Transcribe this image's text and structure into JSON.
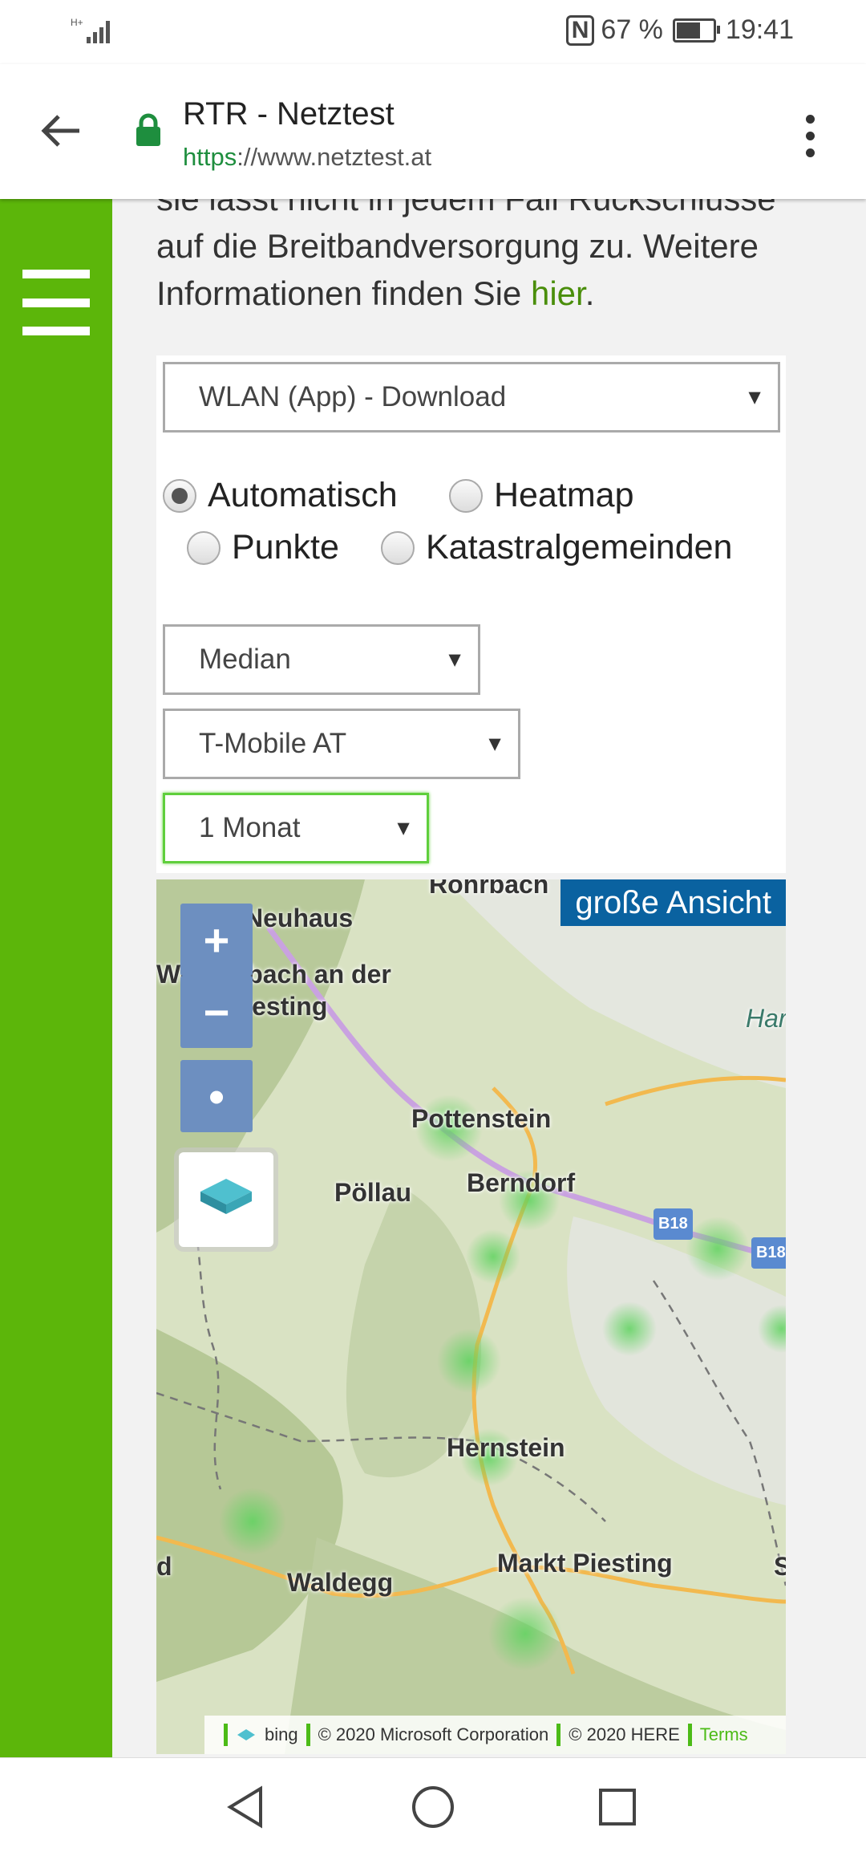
{
  "status_bar": {
    "network": "H+",
    "battery_text": "67 %",
    "battery_level": 0.67,
    "time": "19:41"
  },
  "toolbar": {
    "title": "RTR - Netztest",
    "url_scheme": "https",
    "url_rest": "://www.netztest.at"
  },
  "intro": {
    "line1": "sie lässt nicht in jedem Fall Rückschlüsse",
    "line2": "auf die Breitbandversorgung zu. Weitere",
    "line3_prefix": "Informationen finden Sie ",
    "link": "hier",
    "line3_suffix": "."
  },
  "filters": {
    "measurement_type": "WLAN (App) - Download",
    "statistic": "Median",
    "operator": "T-Mobile AT",
    "period": "1 Monat"
  },
  "view_mode": {
    "selected": "Automatisch",
    "options": [
      "Automatisch",
      "Heatmap",
      "Punkte",
      "Katastralgemeinden"
    ]
  },
  "map": {
    "zoom_in": "+",
    "zoom_out": "−",
    "locate": "•",
    "large_view": "große Ansicht",
    "places": {
      "rohrbach": "Rohrbach",
      "neuhaus": "Neuhaus",
      "weissenbach": "Weißenbach an der",
      "triesting": "Triesting",
      "pottenstein": "Pottenstein",
      "berndorf": "Berndorf",
      "poellau": "Pöllau",
      "hernstein": "Hernstein",
      "waldegg": "Waldegg",
      "markt_piesting": "Markt Piesting",
      "har": "Har",
      "d": "d",
      "s": "S"
    },
    "road_b18": "B18",
    "road_b18_right": "B18",
    "attribution": {
      "bing": "bing",
      "microsoft": "© 2020 Microsoft Corporation",
      "here": "© 2020 HERE",
      "terms": "Terms"
    }
  }
}
